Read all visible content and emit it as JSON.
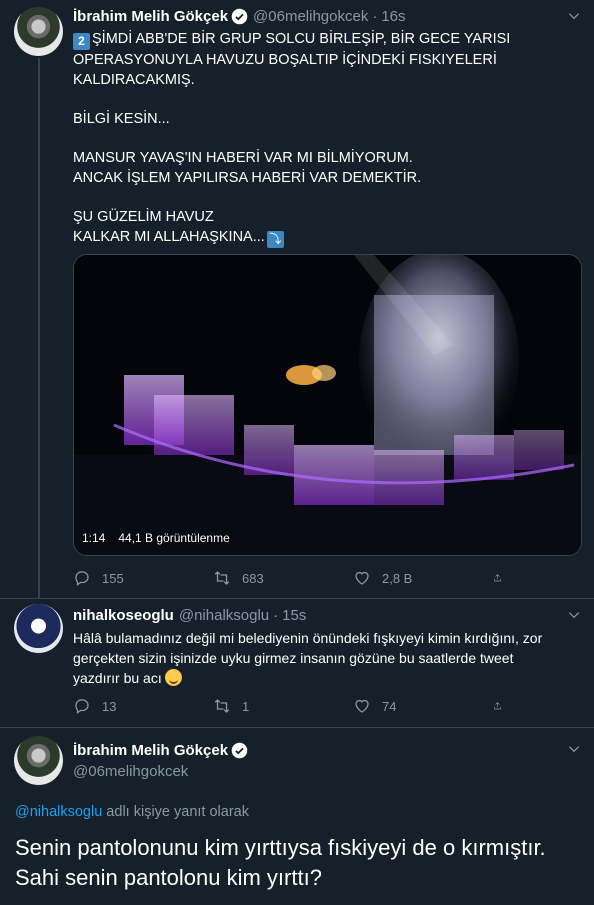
{
  "tweet1": {
    "name": "İbrahim Melih Gökçek",
    "handle": "@06melihgokcek",
    "dot": "·",
    "time": "16s",
    "keycap": "2",
    "lines": [
      "ŞİMDİ ABB'DE BİR GRUP SOLCU BİRLEŞİP, BİR GECE YARISI",
      "OPERASYONUYLA HAVUZU BOŞALTIP İÇİNDEKİ FISKIYELERİ",
      "KALDIRACAKMIŞ.",
      "",
      "BİLGİ KESİN...",
      "",
      "MANSUR YAVAŞ'IN HABERİ VAR MI BİLMİYORUM.",
      "ANCAK İŞLEM YAPILIRSA HABERİ VAR DEMEKTİR.",
      "",
      "ŞU GÜZELİM HAVUZ",
      "KALKAR MI ALLAHAŞKINA..."
    ],
    "arrow": "⤵",
    "video": {
      "duration": "1:14",
      "views": "44,1 B görüntülenme"
    },
    "actions": {
      "replies": "155",
      "retweets": "683",
      "likes": "2,8 B"
    }
  },
  "tweet2": {
    "name": "nihalkoseoglu",
    "handle": "@nihalksoglu",
    "dot": "·",
    "time": "15s",
    "lines": [
      "Hâlâ bulamadınız değil mi belediyenin önündeki fışkıyeyi kimin kırdığını, zor",
      "gerçekten sizin işinizde uyku girmez insanın gözüne bu saatlerde tweet",
      "yazdırır bu acı"
    ],
    "actions": {
      "replies": "13",
      "retweets": "1",
      "likes": "74"
    }
  },
  "tweet3": {
    "name": "İbrahim Melih Gökçek",
    "handle": "@06melihgokcek",
    "reply_mention": "@nihalksoglu",
    "reply_suffix": " adlı kişiye yanıt olarak",
    "lines": [
      "Senin pantolonunu kim yırttıysa fıskiyeyi de o kırmıştır.",
      "Sahi senin pantolonu kim yırttı?"
    ]
  },
  "icons": [
    "verified-icon",
    "chevron-down-icon",
    "reply-icon",
    "retweet-icon",
    "like-icon",
    "share-icon"
  ],
  "colors": {
    "background": "#15202b",
    "secondary_text": "#8899a6",
    "link": "#1da1f2",
    "divider": "#38444d"
  }
}
